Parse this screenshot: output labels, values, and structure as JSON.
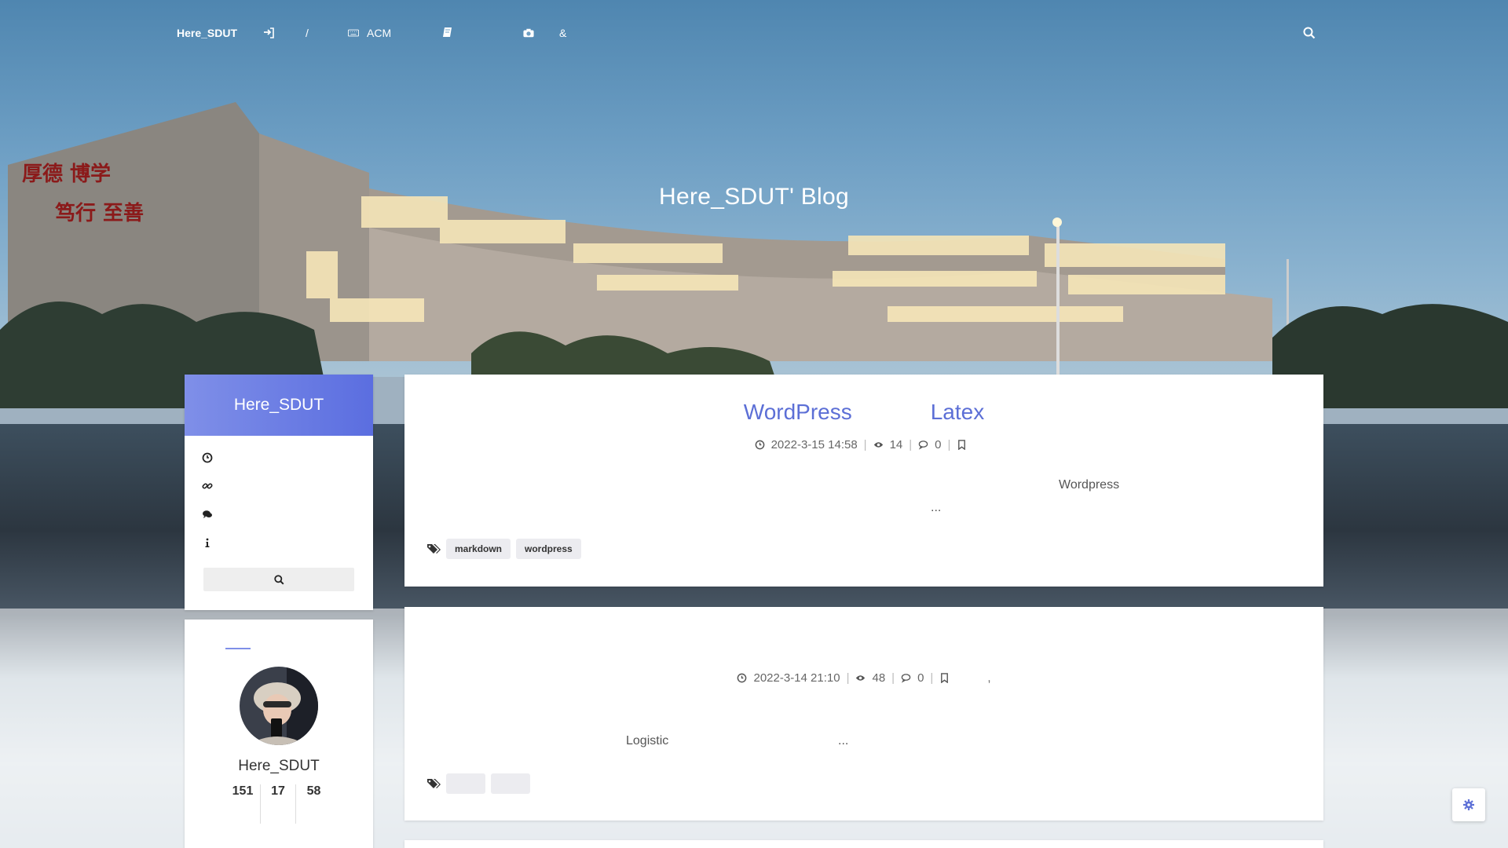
{
  "nav": {
    "brand": "Here_SDUT",
    "items": [
      {
        "label": "/",
        "icon": "sign-in-icon"
      },
      {
        "label": "ACM",
        "icon": "keyboard-icon"
      },
      {
        "label": "",
        "icon": "book-icon"
      },
      {
        "label": "&",
        "icon": "camera-icon"
      }
    ],
    "search_icon": "search-icon"
  },
  "hero": {
    "title": "Here_SDUT' Blog"
  },
  "sidebar": {
    "site_name": "Here_SDUT",
    "menu": [
      {
        "icon": "clock-icon",
        "label": ""
      },
      {
        "icon": "link-icon",
        "label": ""
      },
      {
        "icon": "comments-icon",
        "label": ""
      },
      {
        "icon": "info-icon",
        "label": ""
      }
    ],
    "search_icon": "search-icon"
  },
  "profile": {
    "name": "Here_SDUT",
    "stats": [
      "151",
      "17",
      "58"
    ]
  },
  "posts": [
    {
      "title_parts": [
        "WordPress",
        "Latex"
      ],
      "date": "2022-3-15 14:58",
      "views": "14",
      "comments": "0",
      "category": "",
      "excerpt_line1": "Wordpress",
      "excerpt_line2": "...",
      "tags": [
        "markdown",
        "wordpress"
      ]
    },
    {
      "title_parts": [],
      "date": "2022-3-14 21:10",
      "views": "48",
      "comments": "0",
      "category": ",",
      "excerpt_line1": "Logistic",
      "excerpt_line2": "...",
      "tags": [
        "",
        ""
      ]
    }
  ],
  "colors": {
    "accent": "#5c6fd6",
    "header_gradient_start": "#7f8fe8",
    "header_gradient_end": "#5b6ee0"
  }
}
